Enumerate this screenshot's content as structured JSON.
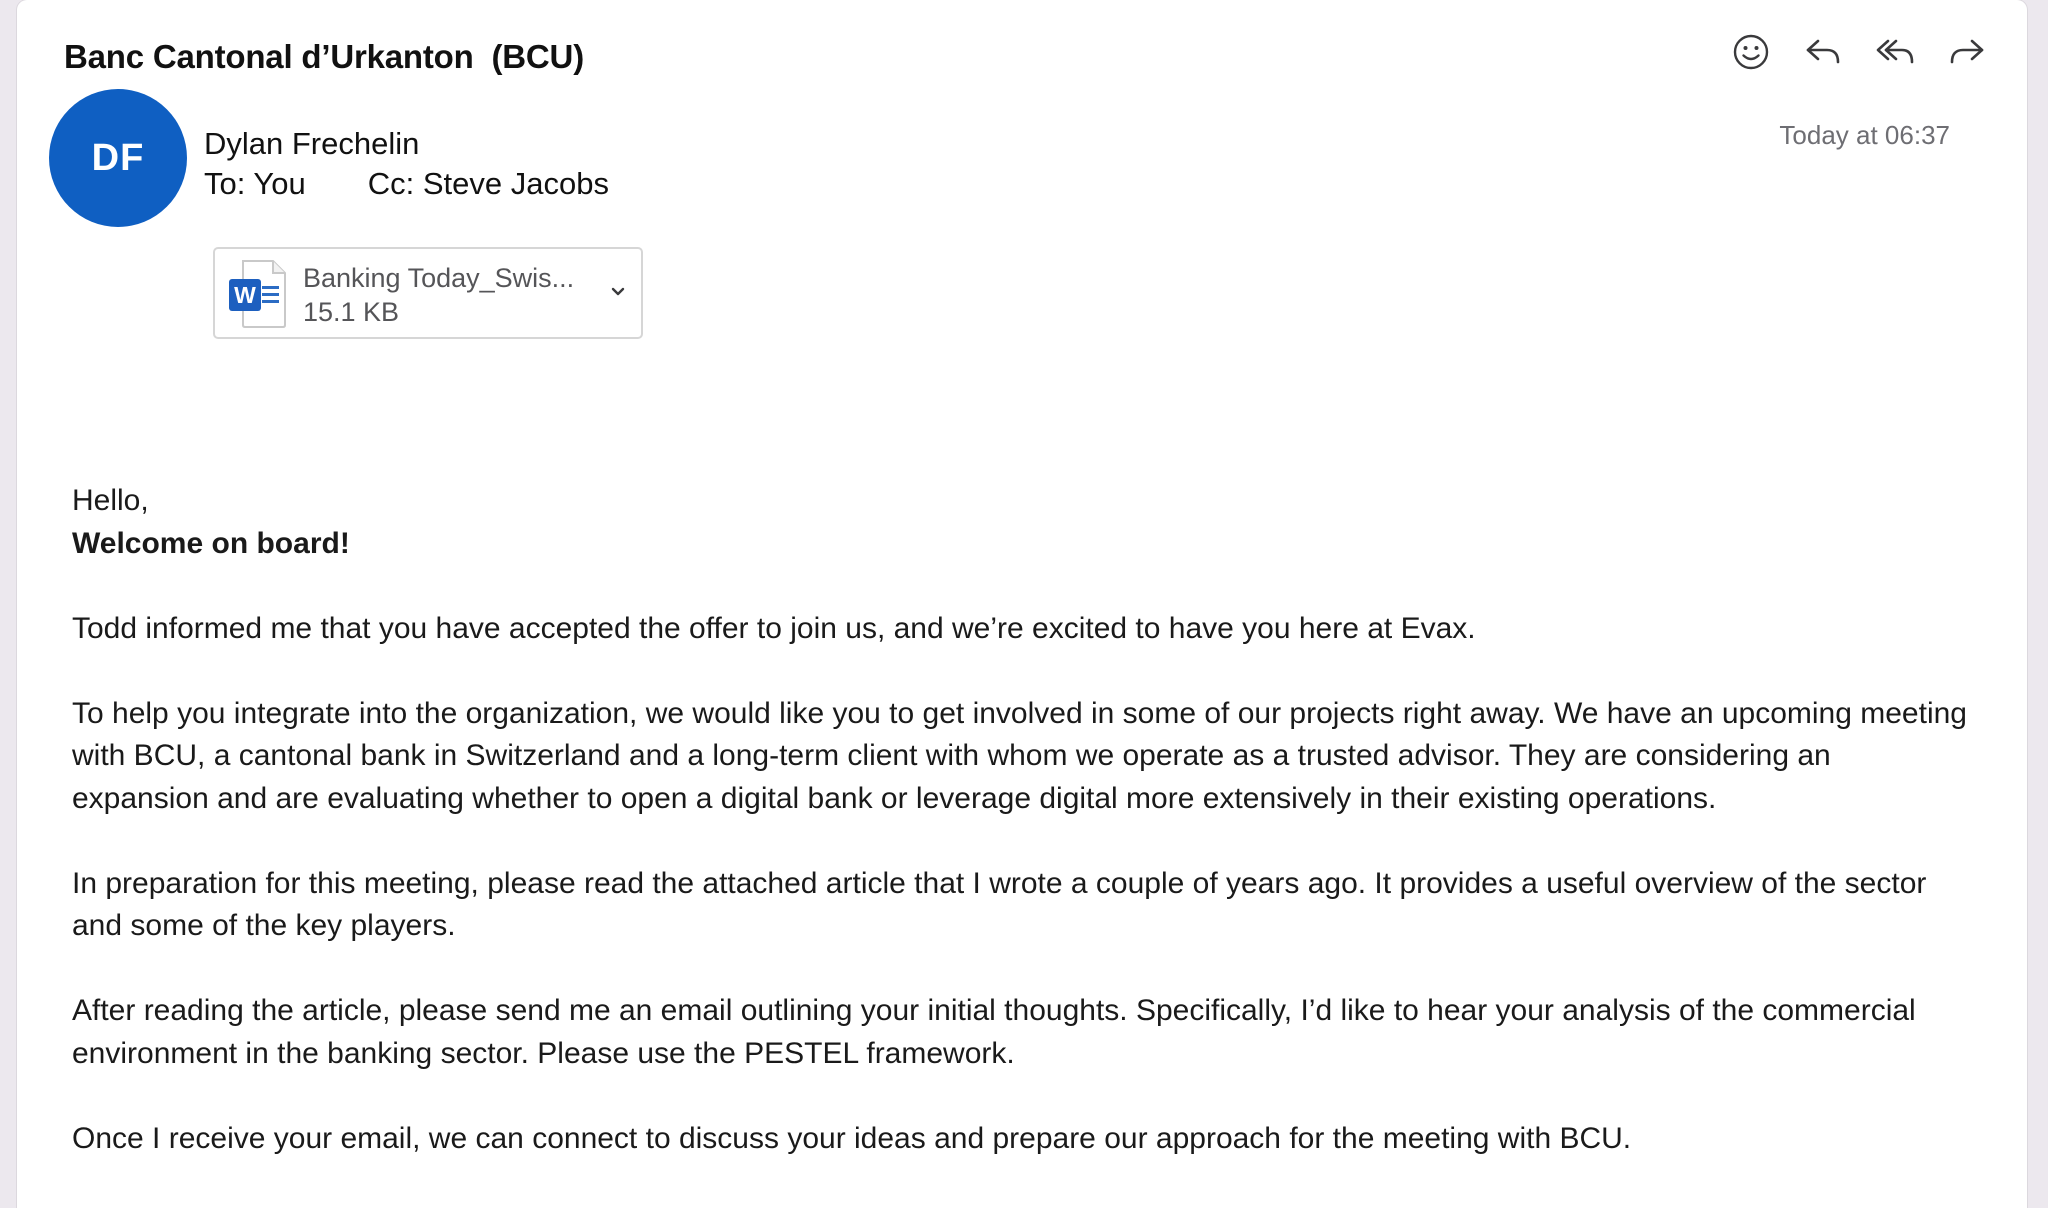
{
  "email": {
    "subject": "Banc Cantonal d’Urkanton  (BCU)",
    "toolbar": {
      "emoji_icon": "smiley-icon",
      "reply_icon": "reply-icon",
      "reply_all_icon": "reply-all-icon",
      "forward_icon": "forward-icon"
    },
    "sender": {
      "initials": "DF",
      "name": "Dylan Frechelin",
      "avatar_color": "#0f5fc2"
    },
    "to": "To: You",
    "cc": "Cc: Steve Jacobs",
    "timestamp": "Today at 06:37",
    "attachment": {
      "name": "Banking Today_Swis...",
      "size": "15.1 KB",
      "icon": "word-document-icon"
    },
    "body": {
      "greeting": "Hello,",
      "welcome": "Welcome on board!",
      "p1": "Todd informed me that you have accepted the offer to join us, and we’re excited to have you here at Evax.",
      "p2": "To help you integrate into the organization, we would like you to get involved in some of our projects right away. We have an upcoming meeting with BCU, a cantonal bank in Switzerland and a long-term client with whom we operate as a trusted advisor. They are considering an expansion and are evaluating whether to open a digital bank or leverage digital more extensively in their existing operations.",
      "p3": "In preparation for this meeting, please read the attached article that I wrote a couple of years ago. It provides a useful overview of the sector and some of the key players.",
      "p4": "After reading the article, please send me an email outlining your initial thoughts. Specifically, I’d like to hear your analysis of the commercial environment in the banking sector. Please use the PESTEL framework.",
      "p5": "Once I receive your email, we can connect to discuss your ideas and prepare our approach for the meeting with BCU."
    }
  }
}
